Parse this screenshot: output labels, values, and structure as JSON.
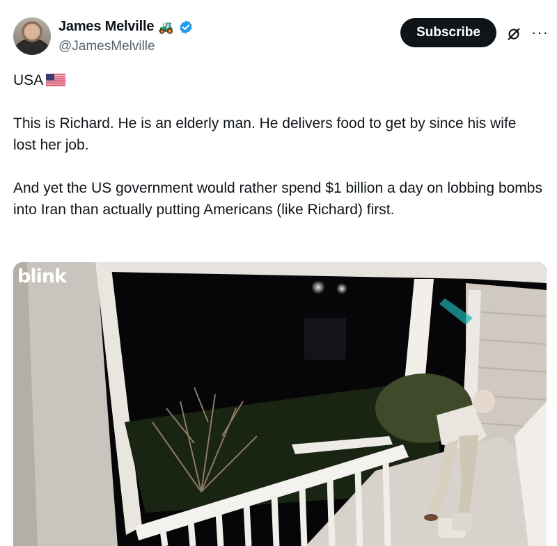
{
  "author": {
    "display_name": "James Melville",
    "handle": "@JamesMelville",
    "badge_icon": "tractor-icon",
    "verified_icon": "verified-badge-icon",
    "verified_color": "#1d9bf0"
  },
  "actions": {
    "subscribe_label": "Subscribe",
    "grok_icon": "grok-icon",
    "more_icon": "more-options-icon"
  },
  "tweet": {
    "line1": "USA",
    "flag_icon": "us-flag-icon",
    "paragraph1": "This is Richard. He is an elderly man. He delivers food to get by since his wife lost her job.",
    "paragraph2": "And yet the US government would rather spend $1 billion a day on lobbing bombs into Iran than actually putting Americans (like Richard) first."
  },
  "media": {
    "watermark": "blink",
    "description_icon": "doorbell-camera-video"
  }
}
